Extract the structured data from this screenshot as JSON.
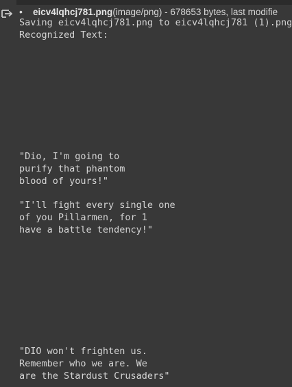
{
  "output": {
    "file_name": "eicv4lqhcj781.png",
    "file_meta": "(image/png) - 678653 bytes, last modifie",
    "saving_line": "Saving eicv4lqhcj781.png to eicv4lqhcj781 (1).png",
    "recognized_label": "Recognized Text:",
    "quote1": [
      "\"Dio, I'm going to",
      "purify that phantom",
      "blood of yours!\""
    ],
    "quote2": [
      "\"I'll fight every single one",
      "of you Pillarmen, for 1",
      "have a battle tendency!\""
    ],
    "quote3": [
      "\"DIO won't frighten us.",
      "Remember who we are. We",
      "are the Stardust Crusaders\""
    ]
  },
  "icons": {
    "output_icon": "output-redirect-icon"
  },
  "colors": {
    "background": "#383838",
    "text": "#d4d4d4"
  }
}
